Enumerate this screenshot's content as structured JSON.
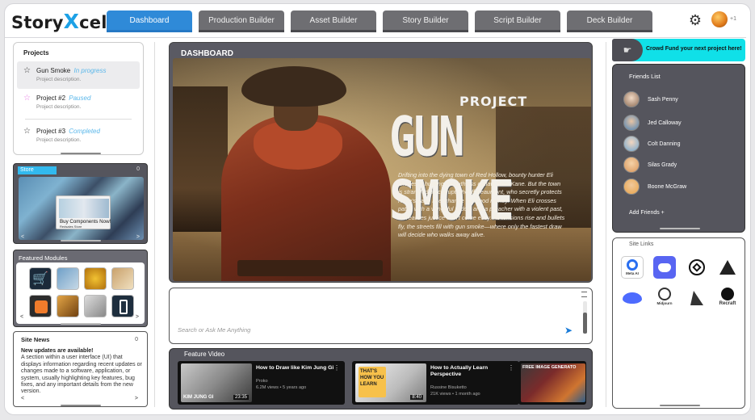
{
  "brand": {
    "name_prefix": "Story",
    "name_x": "X",
    "name_suffix": "cel"
  },
  "tabs": [
    {
      "label": "Dashboard"
    },
    {
      "label": "Production Builder"
    },
    {
      "label": "Asset Builder"
    },
    {
      "label": "Story Builder"
    },
    {
      "label": "Script Builder"
    },
    {
      "label": "Deck Builder"
    }
  ],
  "header": {
    "extra_count": "+1",
    "settings_icon": "gear-icon",
    "accent": "#2f8ad8"
  },
  "projects": {
    "title": "Projects",
    "items": [
      {
        "name": "Gun Smoke",
        "status": "In progress",
        "description": "Project description.",
        "status_color": "#5ab7ea"
      },
      {
        "name": "Project #2",
        "status": "Paused",
        "description": "Project description.",
        "status_color": "#5ab7ea"
      },
      {
        "name": "Project #3",
        "status": "Completed",
        "description": "Project description.",
        "status_color": "#5ab7ea"
      }
    ]
  },
  "store": {
    "label": "Store",
    "count": "0",
    "promo_title": "Buy Components Now!",
    "promo_sub": "Redsales Store",
    "prev": "<",
    "next": ">"
  },
  "featured": {
    "title": "Featured Modules",
    "prev": "<",
    "next": ">"
  },
  "news": {
    "title": "Site News",
    "count": "0",
    "headline": "New updates are available!",
    "body": "A section within a user interface (UI) that displays information regarding recent updates or changes made to a software, application, or system, usually highlighting key features, bug fixes, and any important details from the new version.",
    "prev": "<",
    "next": ">"
  },
  "dashboard": {
    "title": "DASHBOARD",
    "hero_kicker": "PROJECT",
    "hero_title": "GUN SMOKE",
    "hero_story": "Drifting into the dying town of Red Hollow, bounty hunter Eli Graves is hunting the ruthless outlaw Silas Kane. But the town is strangled by corrupt Sheriff Beaumont, who secretly protects Kane's gang in exchange for blood money. When Eli crosses paths with a vengeful widow and a preacher with a violent past, he realizes justice won't come easy. As tensions rise and bullets fly, the streets fill with gun smoke—where only the fastest draw will decide who walks away alive."
  },
  "chat": {
    "placeholder": "Search or Ask  Me Anything",
    "send_icon": "send-icon"
  },
  "feature_video": {
    "title": "Feature Video",
    "videos": [
      {
        "title": "How to Draw like Kim Jung Gi",
        "channel": "Proko",
        "meta": "6.2M views • 5 years ago",
        "duration": "23:35",
        "thumb_text": "KIM JUNG GI"
      },
      {
        "title": "How to Actually Learn Perspective",
        "channel": "Russine Bisuketto",
        "meta": "21K views • 1 month ago",
        "duration": "8:40",
        "thumb_text": "THAT'S HOW YOU LEARN"
      },
      {
        "title": "FREE IMAGE GENERATO",
        "channel": "",
        "meta": "",
        "duration": "",
        "thumb_text": "FREE IMAGE GENERATO"
      }
    ]
  },
  "crowd": {
    "text": "Crowd Fund your next project here!",
    "color": "#10e0e8"
  },
  "friends": {
    "title": "Friends List",
    "items": [
      {
        "name": "Sash Penny"
      },
      {
        "name": "Jed Calloway"
      },
      {
        "name": "Colt Danning"
      },
      {
        "name": "Silas Grady"
      },
      {
        "name": "Boone McGraw"
      }
    ],
    "add_label": "Add Friends +"
  },
  "site_links": {
    "title": "Site Links",
    "items": [
      {
        "name": "meta-ai",
        "caption": "Meta AI"
      },
      {
        "name": "discord",
        "caption": ""
      },
      {
        "name": "openai",
        "caption": ""
      },
      {
        "name": "delta-ai",
        "caption": ""
      },
      {
        "name": "deepseek",
        "caption": ""
      },
      {
        "name": "midjourney",
        "caption": "Midjourn"
      },
      {
        "name": "sailboat",
        "caption": ""
      },
      {
        "name": "recraft",
        "caption": "Recraft"
      }
    ]
  }
}
